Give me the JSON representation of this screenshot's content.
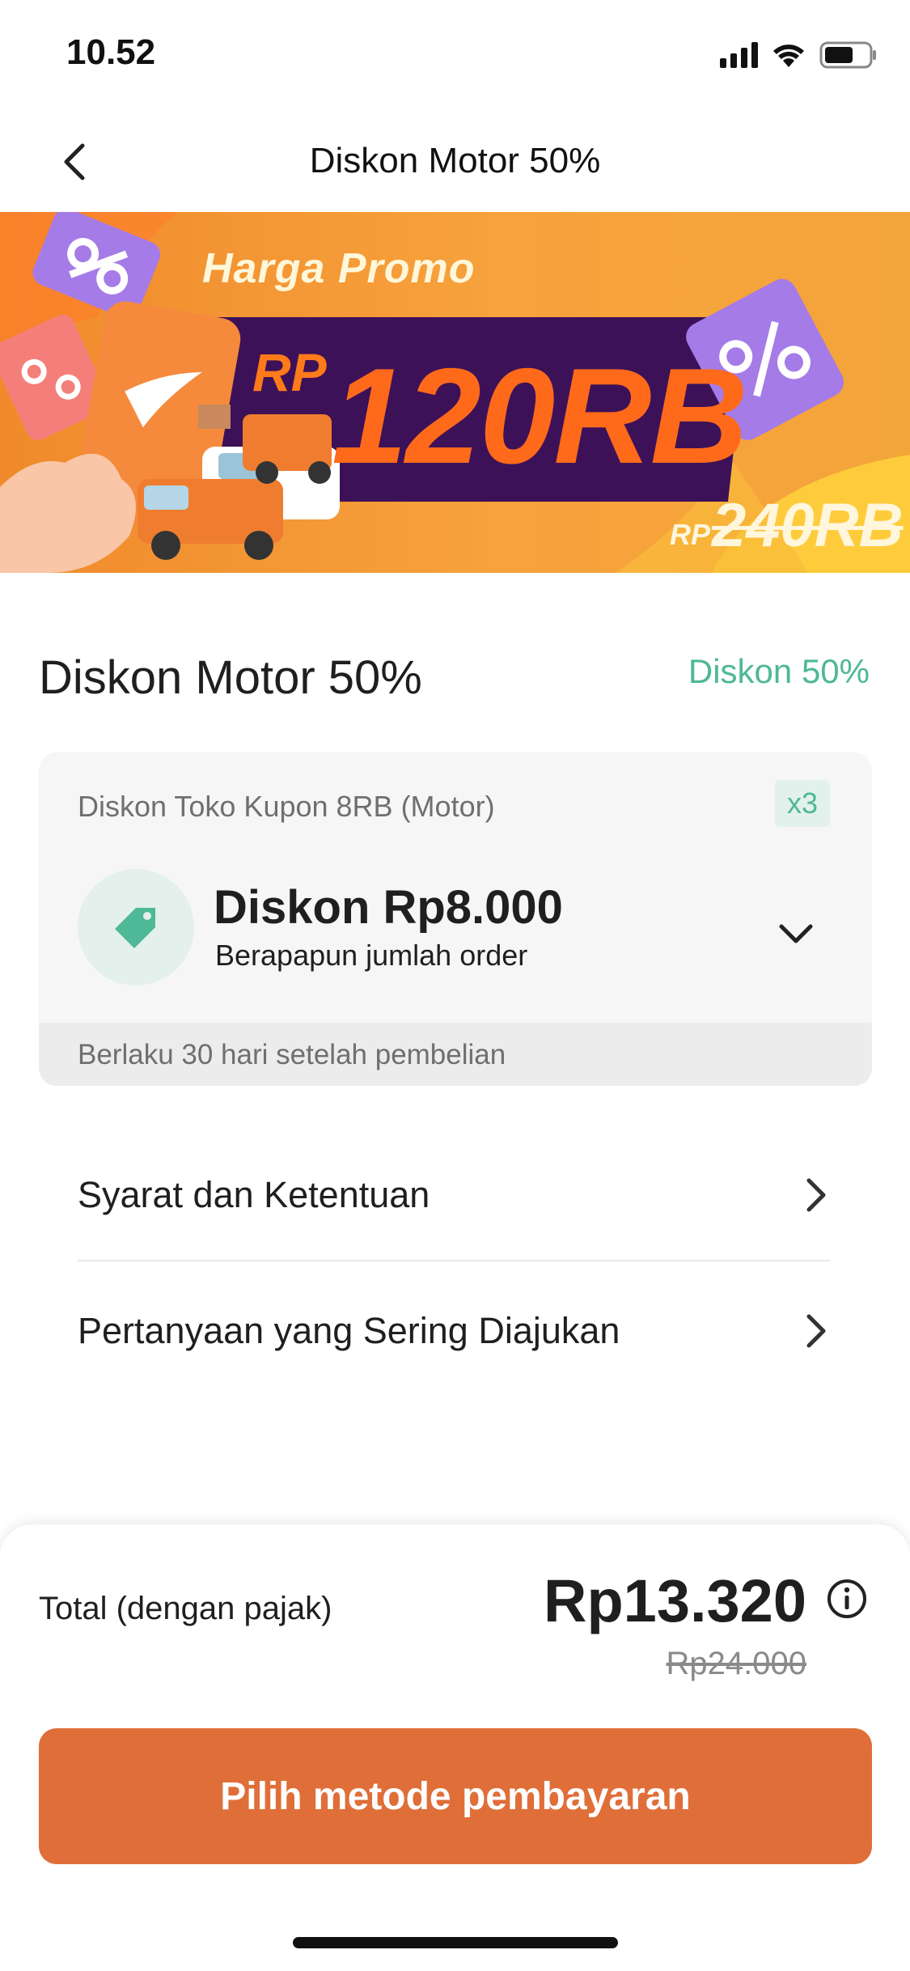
{
  "status_bar": {
    "time": "10.52"
  },
  "nav": {
    "title": "Diskon Motor 50%"
  },
  "banner": {
    "subtitle": "Harga Promo",
    "price_currency": "RP",
    "price": "120RB",
    "old_price_currency": "RP",
    "old_price": "240RB"
  },
  "product": {
    "title": "Diskon Motor 50%",
    "discount_badge": "Diskon 50%"
  },
  "coupon": {
    "name": "Diskon Toko Kupon 8RB (Motor)",
    "quantity": "x3",
    "amount": "Diskon Rp8.000",
    "condition": "Berapapun jumlah order",
    "validity": "Berlaku 30 hari setelah pembelian"
  },
  "links": [
    {
      "label": "Syarat dan Ketentuan"
    },
    {
      "label": "Pertanyaan yang Sering Diajukan"
    }
  ],
  "checkout": {
    "total_label": "Total (dengan pajak)",
    "total_price": "Rp13.320",
    "original_price": "Rp24.000",
    "pay_button_label": "Pilih metode pembayaran"
  },
  "colors": {
    "accent_green": "#4eb897",
    "primary_button": "#e06e38",
    "banner_orange": "#f08a2c",
    "banner_purple": "#3d1158"
  },
  "icons": [
    "back-arrow-icon",
    "coupon-tag-icon",
    "chevron-down-icon",
    "chevron-right-icon",
    "info-icon",
    "signal-icon",
    "wifi-icon",
    "battery-icon"
  ]
}
